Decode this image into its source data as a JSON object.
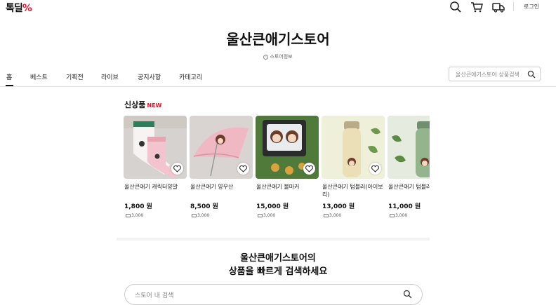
{
  "header": {
    "logo_main": "톡딜",
    "logo_pct": "%",
    "login_label": "로그인"
  },
  "store": {
    "title": "울산큰애기스토어",
    "info_label": "스토어정보"
  },
  "nav": {
    "items": [
      {
        "label": "홈"
      },
      {
        "label": "베스트"
      },
      {
        "label": "기획전"
      },
      {
        "label": "라이브"
      },
      {
        "label": "공지사항"
      },
      {
        "label": "카테고리"
      }
    ],
    "search_placeholder": "울산큰애기스토어 상품검색"
  },
  "new_section": {
    "title": "신상품",
    "badge": "NEW"
  },
  "products": [
    {
      "name": "울산큰애기 캐릭터양말",
      "price": "1,800 원",
      "shipping": "3,000"
    },
    {
      "name": "울산큰애기 양우산",
      "price": "8,500 원",
      "shipping": "3,000"
    },
    {
      "name": "울산큰애기 볼마커",
      "price": "15,000 원",
      "shipping": "3,000"
    },
    {
      "name": "울산큰애기 텀블러(아이보리)",
      "price": "13,000 원",
      "shipping": "3,000"
    },
    {
      "name": "울산큰애기 텀블러(그린)",
      "price": "11,000 원",
      "shipping": "3,000"
    }
  ],
  "search_cta": {
    "line1": "울산큰애기스토어의",
    "line2": "상품을 빠르게 검색하세요",
    "placeholder": "스토어 내 검색"
  },
  "colors": {
    "accent_red": "#e5142a"
  }
}
